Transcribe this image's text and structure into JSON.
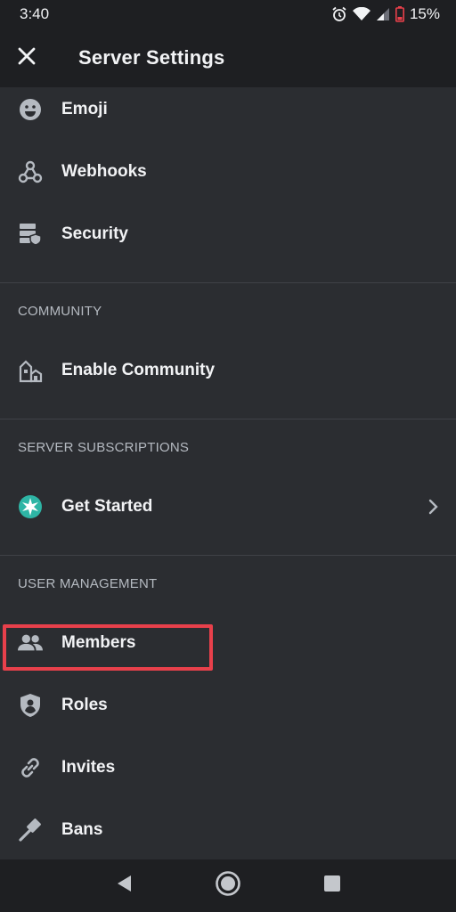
{
  "status_bar": {
    "time": "3:40",
    "battery": "15%",
    "icons": [
      "alarm-icon",
      "wifi-icon",
      "cell-signal-icon",
      "battery-icon"
    ],
    "battery_color": "#e8404b"
  },
  "header": {
    "title": "Server Settings",
    "close_icon": "close-icon"
  },
  "sections": {
    "top_items": [
      {
        "label": "Emoji",
        "icon": "emoji-icon"
      },
      {
        "label": "Webhooks",
        "icon": "webhooks-icon"
      },
      {
        "label": "Security",
        "icon": "security-icon"
      }
    ],
    "community": {
      "title": "COMMUNITY",
      "items": [
        {
          "label": "Enable Community",
          "icon": "community-icon"
        }
      ]
    },
    "subscriptions": {
      "title": "SERVER SUBSCRIPTIONS",
      "items": [
        {
          "label": "Get Started",
          "icon": "subscription-star-icon",
          "chevron": "chevron-right-icon"
        }
      ]
    },
    "user_management": {
      "title": "USER MANAGEMENT",
      "items": [
        {
          "label": "Members",
          "icon": "members-icon",
          "highlighted": true
        },
        {
          "label": "Roles",
          "icon": "roles-shield-icon"
        },
        {
          "label": "Invites",
          "icon": "link-icon"
        },
        {
          "label": "Bans",
          "icon": "ban-hammer-icon"
        }
      ]
    }
  },
  "colors": {
    "background": "#2b2d31",
    "header_bg": "#1e1f22",
    "highlight": "#e8404b",
    "subscription_icon": "#2eb5a5"
  },
  "nav_bar": {
    "buttons": [
      "back-icon",
      "home-icon",
      "recents-icon"
    ]
  }
}
